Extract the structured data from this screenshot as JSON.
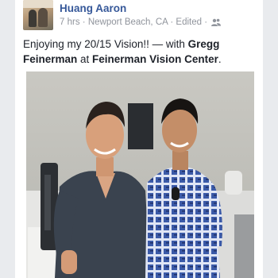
{
  "post": {
    "author": "Huang Aaron",
    "time": "7 hrs",
    "separator": " · ",
    "location": "Newport Beach, CA",
    "edited": "Edited",
    "audience_icon": "friends-icon",
    "status_prefix": "Enjoying my 20/15 Vision!! — with ",
    "tagged_person": "Gregg Feinerman",
    "at_word": " at ",
    "place": "Feinerman Vision Center",
    "period": "."
  },
  "colors": {
    "name_link": "#365899",
    "meta_gray": "#90949c",
    "text": "#1d2129"
  }
}
